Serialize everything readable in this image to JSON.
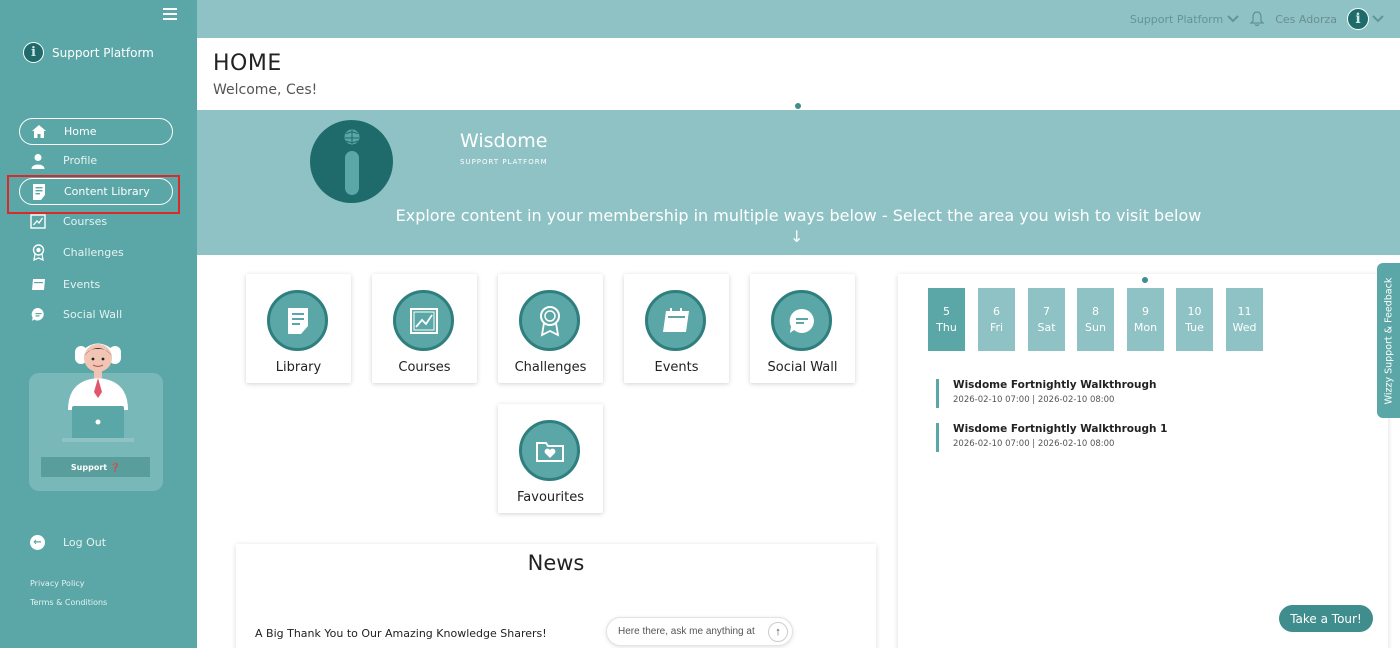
{
  "sidebar": {
    "brand": "Support Platform",
    "logo_letter": "i",
    "items": [
      {
        "label": "Home",
        "icon": "home-icon"
      },
      {
        "label": "Profile",
        "icon": "user-icon"
      },
      {
        "label": "Content Library",
        "icon": "document-icon"
      },
      {
        "label": "Courses",
        "icon": "courses-icon"
      },
      {
        "label": "Challenges",
        "icon": "award-icon"
      },
      {
        "label": "Events",
        "icon": "calendar-icon"
      },
      {
        "label": "Social Wall",
        "icon": "chat-icon"
      }
    ],
    "support_label": "Support",
    "logout_label": "Log Out",
    "footer_links": [
      "Privacy Policy",
      "Terms & Conditions"
    ]
  },
  "topbar": {
    "platform": "Support Platform",
    "user": "Ces Adorza",
    "avatar_letter": "i"
  },
  "header": {
    "title": "HOME",
    "welcome": "Welcome, Ces!"
  },
  "banner": {
    "brand": "Wisdome",
    "subtitle": "SUPPORT PLATFORM",
    "explore_text": "Explore content in your membership in multiple ways below - Select the area you wish to visit below",
    "arrow": "↓"
  },
  "tiles": [
    {
      "label": "Library"
    },
    {
      "label": "Courses"
    },
    {
      "label": "Challenges"
    },
    {
      "label": "Events"
    },
    {
      "label": "Social Wall"
    },
    {
      "label": "Favourites"
    }
  ],
  "news": {
    "title": "News",
    "first_item": "A Big Thank You to Our Amazing Knowledge Sharers!"
  },
  "chat": {
    "placeholder": "Here there, ask me anything at",
    "send": "↑"
  },
  "calendar": {
    "days": [
      {
        "num": "5",
        "dow": "Thu",
        "active": true
      },
      {
        "num": "6",
        "dow": "Fri"
      },
      {
        "num": "7",
        "dow": "Sat"
      },
      {
        "num": "8",
        "dow": "Sun"
      },
      {
        "num": "9",
        "dow": "Mon"
      },
      {
        "num": "10",
        "dow": "Tue"
      },
      {
        "num": "11",
        "dow": "Wed"
      }
    ],
    "events": [
      {
        "title": "Wisdome Fortnightly Walkthrough",
        "time": "2026-02-10 07:00 | 2026-02-10 08:00"
      },
      {
        "title": "Wisdome Fortnightly Walkthrough 1",
        "time": "2026-02-10 07:00 | 2026-02-10 08:00"
      }
    ]
  },
  "feedback_tab": "Wizzy Support & Feedback",
  "tour_button": "Take a Tour!",
  "colors": {
    "sidebar": "#5ba6a6",
    "topbar": "#8fc2c4",
    "accent_dark": "#1f6b6b",
    "highlight": "#d92a2a"
  }
}
